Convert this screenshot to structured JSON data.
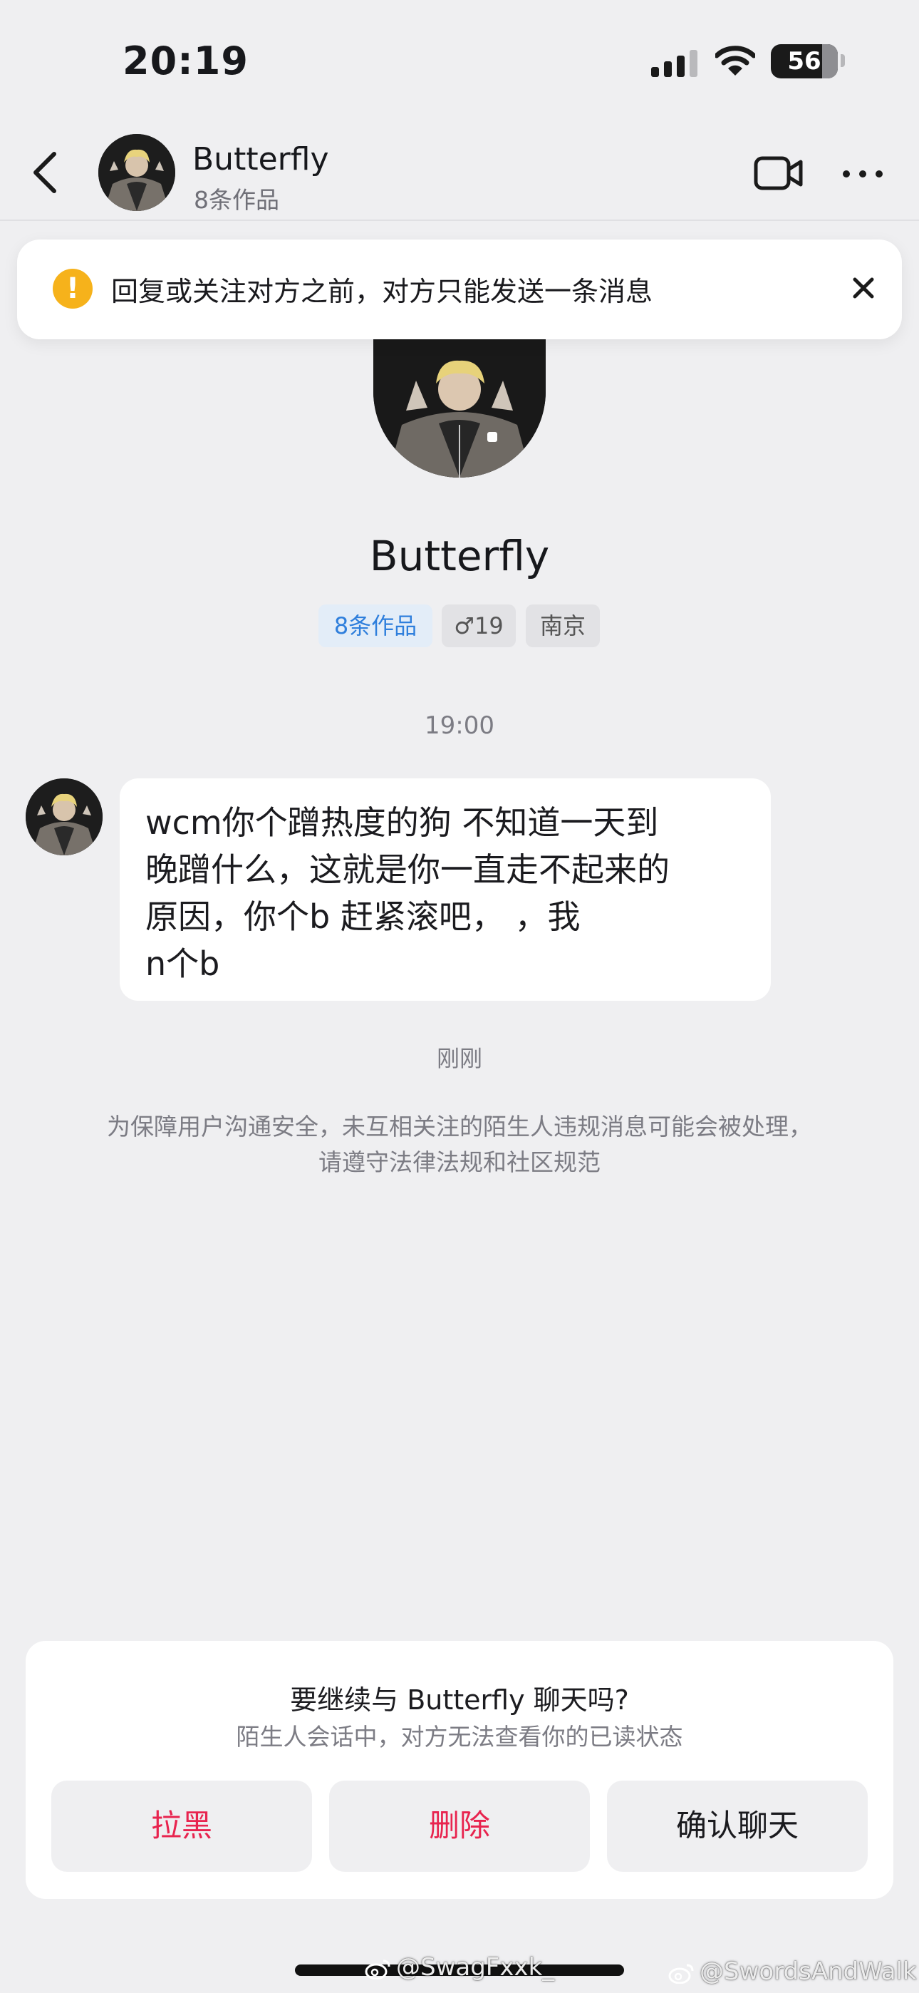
{
  "status_bar": {
    "time": "20:19",
    "battery": "56"
  },
  "header": {
    "name": "Butterfly",
    "works": "8条作品"
  },
  "banner": {
    "text": "回复或关注对方之前，对方只能发送一条消息"
  },
  "profile": {
    "name": "Butterfly",
    "tags": {
      "works": "8条作品",
      "age": "♂19",
      "city": "南京"
    }
  },
  "chat": {
    "time": "19:00",
    "message_lines": [
      "wcm你个蹭热度的狗 不知道一天到",
      "晚蹭什么，这就是你一直走不起来的",
      "原因，你个b 赶紧滚吧， ，我",
      "n个b"
    ],
    "state": "刚刚",
    "notice": "为保障用户沟通安全，未互相关注的陌生人违规消息可能会被处理，请遵守法律法规和社区规范"
  },
  "prompt": {
    "title": "要继续与 Butterfly 聊天吗?",
    "subtitle": "陌生人会话中，对方无法查看你的已读状态",
    "buttons": {
      "block": "拉黑",
      "delete": "删除",
      "confirm": "确认聊天"
    }
  },
  "watermarks": [
    "@SwagFxxk_",
    "@SwordsAndWalk"
  ],
  "icons": [
    "signal-icon",
    "wifi-icon",
    "battery-icon",
    "back-icon",
    "video-call-icon",
    "more-icon",
    "warning-icon",
    "close-icon",
    "weibo-icon"
  ],
  "colors": {
    "accent_red": "#e8244f",
    "link_blue": "#2f7fdc",
    "warning": "#f6b21b",
    "background": "#efeff1"
  }
}
